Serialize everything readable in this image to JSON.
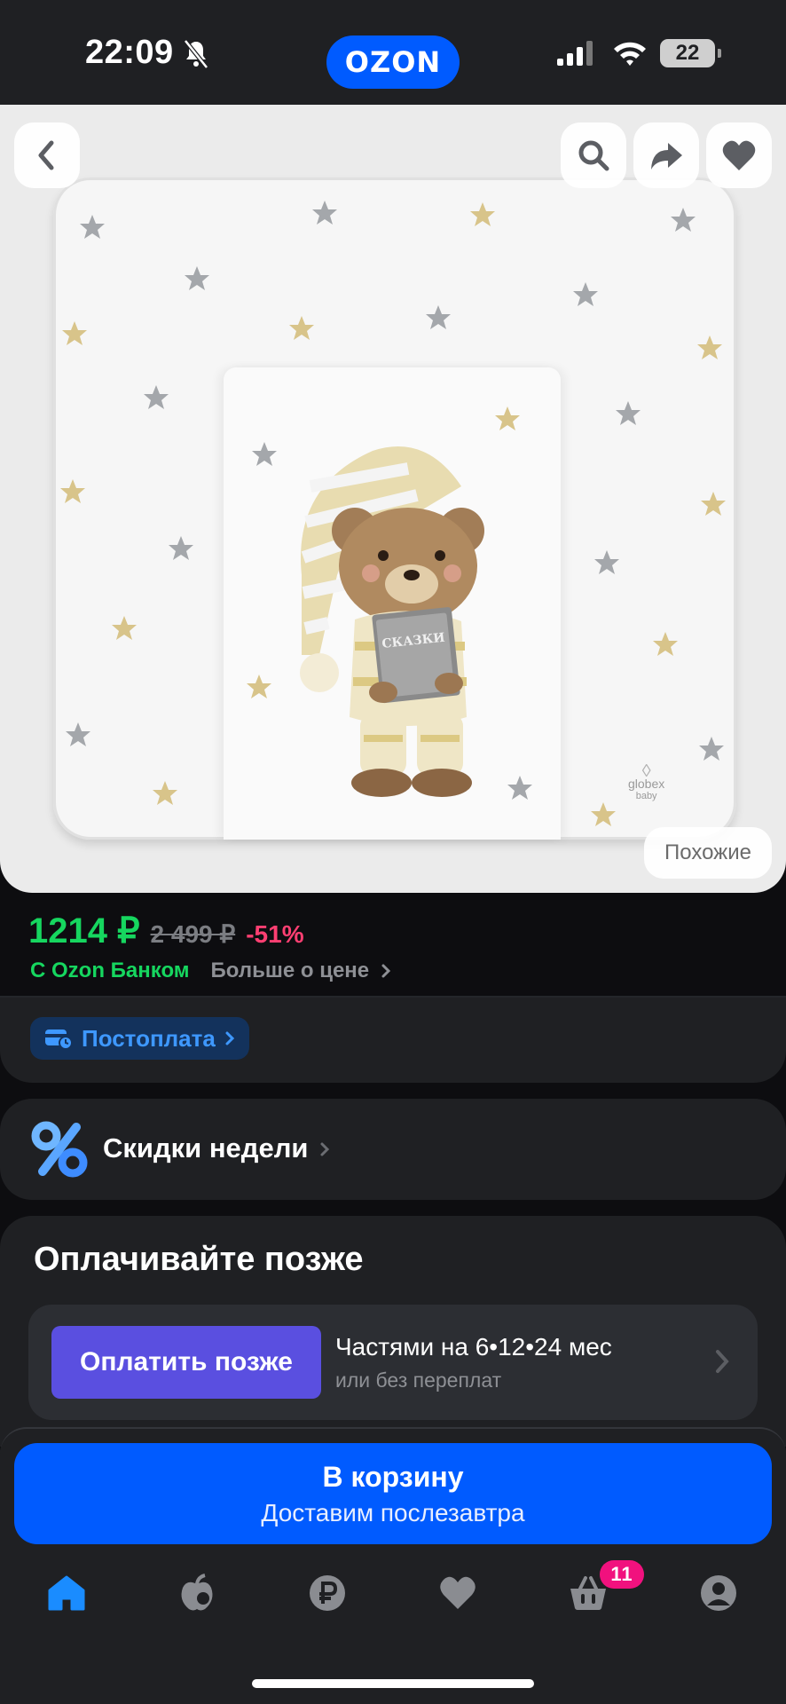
{
  "status_bar": {
    "time": "22:09",
    "battery": "22"
  },
  "header": {
    "logo": "OZON"
  },
  "product": {
    "book_title": "СКАЗКИ",
    "brand_mark": "globex",
    "brand_sub": "baby",
    "similar_label": "Похожие"
  },
  "price": {
    "current": "1214 ₽",
    "old": "2 499 ₽",
    "discount": "-51%",
    "bank_label": "С Ozon Банком",
    "more_label": "Больше о цене"
  },
  "postpay": {
    "label": "Постоплата"
  },
  "discounts": {
    "label": "Скидки недели"
  },
  "pay_later": {
    "title": "Оплачивайте позже",
    "button": "Оплатить позже",
    "installments": "Частями на 6•12•24 мес",
    "installments_sub": "или без переплат"
  },
  "cart": {
    "title": "В корзину",
    "subtitle": "Доставим послезавтра",
    "badge": "11"
  },
  "colors": {
    "accent": "#005bff",
    "price": "#16d65f",
    "discount": "#ff3f72",
    "badge": "#f1117e",
    "pay_later": "#5a4fe0"
  },
  "tabs": [
    "home-icon",
    "fresh-icon",
    "ruble-icon",
    "heart-icon",
    "basket-icon",
    "profile-icon"
  ]
}
